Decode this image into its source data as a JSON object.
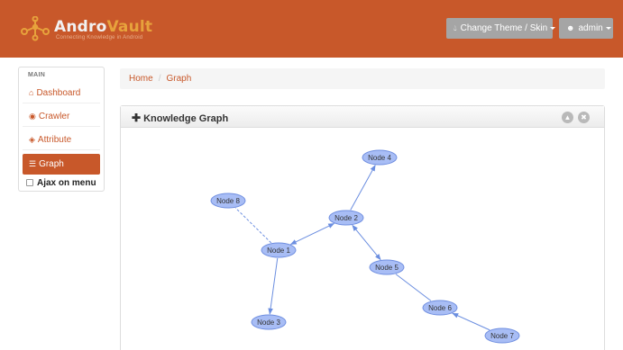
{
  "app": {
    "brand_part1": "Andro",
    "brand_part2": "Vault",
    "tagline": "Connecting Knowledge in Android",
    "accent_color": "#c8582a"
  },
  "topbar": {
    "theme_button": "Change Theme / Skin",
    "admin_button": "admin"
  },
  "sidebar": {
    "header": "MAIN",
    "items": [
      {
        "label": "Dashboard",
        "icon": "home-icon"
      },
      {
        "label": "Crawler",
        "icon": "globe-icon"
      },
      {
        "label": "Attribute",
        "icon": "eye-icon"
      },
      {
        "label": "Graph",
        "icon": "list-icon",
        "active": true
      }
    ],
    "ajax_label": "Ajax on menu"
  },
  "breadcrumb": {
    "home": "Home",
    "current": "Graph"
  },
  "panel": {
    "title": "Knowledge Graph"
  },
  "graph": {
    "nodes": [
      {
        "id": 1,
        "label": "Node 1"
      },
      {
        "id": 2,
        "label": "Node 2"
      },
      {
        "id": 3,
        "label": "Node 3"
      },
      {
        "id": 4,
        "label": "Node 4"
      },
      {
        "id": 5,
        "label": "Node 5"
      },
      {
        "id": 6,
        "label": "Node 6"
      },
      {
        "id": 7,
        "label": "Node 7"
      },
      {
        "id": 8,
        "label": "Node 8"
      }
    ],
    "edges": [
      {
        "from": 1,
        "to": 2,
        "style": "bidirectional"
      },
      {
        "from": 2,
        "to": 4,
        "style": "arrow"
      },
      {
        "from": 2,
        "to": 5,
        "style": "bidirectional"
      },
      {
        "from": 1,
        "to": 3,
        "style": "arrow"
      },
      {
        "from": 1,
        "to": 8,
        "style": "dashed"
      },
      {
        "from": 5,
        "to": 6,
        "style": "line"
      },
      {
        "from": 7,
        "to": 6,
        "style": "arrow"
      }
    ],
    "node_fill": "#a8bdf5",
    "node_stroke": "#6f8ee0",
    "edge_color": "#6b8ee0"
  }
}
